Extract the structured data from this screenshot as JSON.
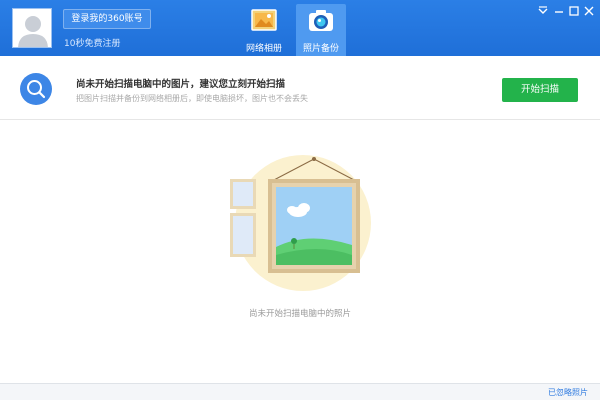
{
  "header": {
    "login_button": "登录我的360账号",
    "register_link": "10秒免费注册",
    "tabs": [
      {
        "label": "网络相册",
        "icon": "photo-album-icon",
        "active": false
      },
      {
        "label": "照片备份",
        "icon": "camera-icon",
        "active": true
      }
    ],
    "window_controls": {
      "menu": "menu-icon",
      "minimize": "minimize-icon",
      "maximize": "maximize-icon",
      "close": "close-icon"
    },
    "colors": {
      "background": "#2476e0",
      "active_tab": "#4f9af0"
    }
  },
  "banner": {
    "icon": "search-icon",
    "title": "尚未开始扫描电脑中的图片，建议您立刻开始扫描",
    "subtitle": "把图片扫描并备份到网络相册后，即使电脑损坏，图片也不会丢失",
    "scan_button": "开始扫描",
    "colors": {
      "scan_button": "#23b34b",
      "icon_bg": "#3d86e6"
    }
  },
  "main": {
    "illustration": "empty-photo-frame-illustration",
    "empty_text": "尚未开始扫描电脑中的照片"
  },
  "footer": {
    "ignored_photos_link": "已忽略照片"
  }
}
